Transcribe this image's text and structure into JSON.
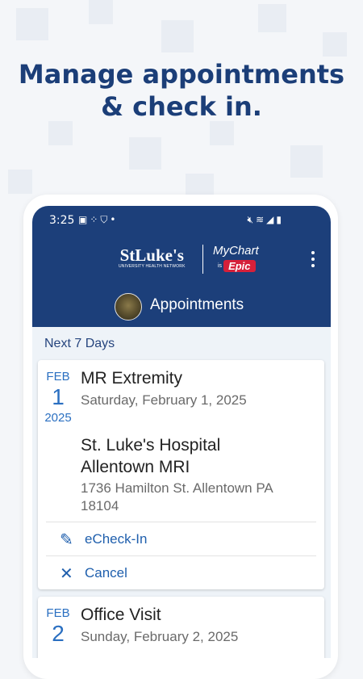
{
  "headline": {
    "line1": "Manage appointments",
    "line2": "& check in."
  },
  "status_bar": {
    "time": "3:25",
    "left_icons": [
      "image-icon",
      "signal-dots-icon",
      "shield-icon",
      "dot-icon"
    ],
    "right_icons": [
      "mute-icon",
      "wifi-icon",
      "cell-signal-icon",
      "battery-icon"
    ]
  },
  "app_bar": {
    "logo_stlukes": "StLuke's",
    "logo_stlukes_sub": "UNIVERSITY HEALTH NETWORK",
    "logo_mychart": "MyChart",
    "logo_is": "is",
    "logo_epic": "Epic",
    "title": "Appointments"
  },
  "section_label": "Next 7 Days",
  "appointments": [
    {
      "month": "FEB",
      "day": "1",
      "year": "2025",
      "name": "MR Extremity",
      "date_text": "Saturday, February 1, 2025",
      "location_line1": "St. Luke's Hospital",
      "location_line2": "Allentown MRI",
      "address_line1": "1736 Hamilton St. Allentown PA",
      "address_line2": "18104",
      "actions": [
        {
          "label": "eCheck-In",
          "icon": "check-in-icon"
        },
        {
          "label": "Cancel",
          "icon": "close-icon"
        }
      ]
    },
    {
      "month": "FEB",
      "day": "2",
      "name": "Office Visit",
      "date_text": "Sunday, February 2, 2025"
    }
  ],
  "colors": {
    "brand_blue": "#1c3f7a",
    "headline_blue": "#1b3e78",
    "accent_blue": "#2a6fc1",
    "epic_red": "#d6203a",
    "background": "#f4f6f9"
  }
}
